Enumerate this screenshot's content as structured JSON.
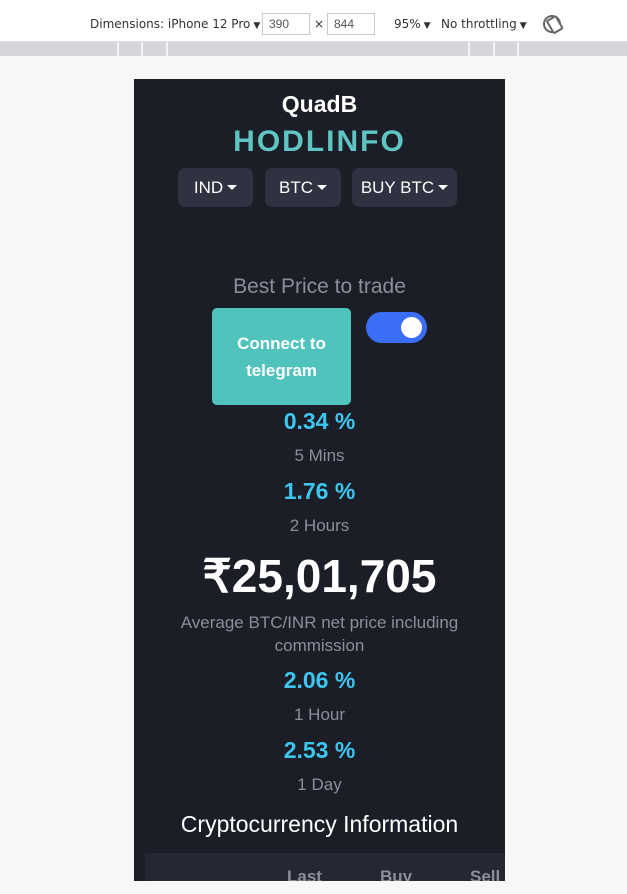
{
  "devtools": {
    "dimensions_label": "Dimensions: iPhone 12 Pro",
    "width": "390",
    "height": "844",
    "zoom": "95%",
    "throttling": "No throttling",
    "times_symbol": "×"
  },
  "header": {
    "brand": "QuadB",
    "title": "HODLINFO"
  },
  "selectors": [
    {
      "label": "IND"
    },
    {
      "label": "BTC"
    },
    {
      "label": "BUY BTC"
    }
  ],
  "best_price_label": "Best Price to trade",
  "telegram_button": "Connect to telegram",
  "toggle": {
    "on": true
  },
  "stats_top": [
    {
      "value": "0.34 %",
      "label": "5 Mins"
    },
    {
      "value": "1.76 %",
      "label": "2 Hours"
    }
  ],
  "price": {
    "value": "₹25,01,705",
    "description": "Average BTC/INR net price including commission"
  },
  "stats_bottom": [
    {
      "value": "2.06 %",
      "label": "1 Hour"
    },
    {
      "value": "2.53 %",
      "label": "1 Day"
    }
  ],
  "crypto_section": {
    "title": "Cryptocurrency Information",
    "columns": [
      "",
      "Last",
      "Buy",
      "Sell"
    ]
  },
  "colors": {
    "accent_teal": "#5ec5c3",
    "percent_blue": "#3dc6f0",
    "toggle_blue": "#3b6ef6",
    "background": "#1b1e27"
  }
}
